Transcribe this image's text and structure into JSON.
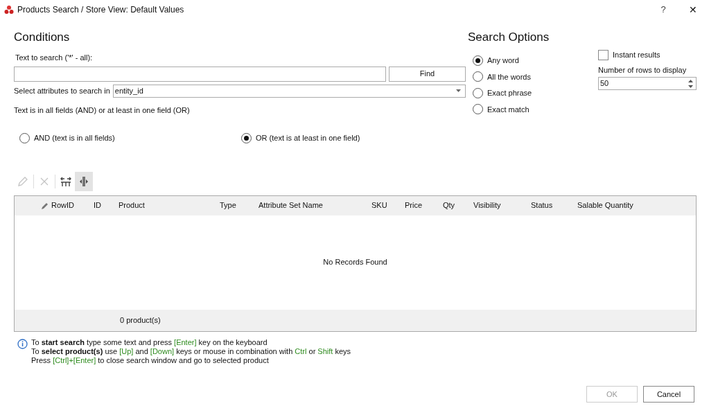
{
  "window": {
    "title": "Products Search / Store View: Default Values",
    "help": "?",
    "close": "✕"
  },
  "conditions": {
    "heading": "Conditions",
    "text_label": "Text to search ('*' - all):",
    "find_button": "Find",
    "attributes_label": "Select attributes to search in",
    "attributes_value": "entity_id",
    "logic_label": "Text is in all fields (AND) or at least in one field (OR)",
    "logic_options": [
      {
        "label": "AND (text is in all fields)",
        "selected": false
      },
      {
        "label": "OR (text is at least in one field)",
        "selected": true
      }
    ]
  },
  "search_options": {
    "heading": "Search Options",
    "modes": [
      {
        "label": "Any word",
        "selected": true
      },
      {
        "label": "All the words",
        "selected": false
      },
      {
        "label": "Exact phrase",
        "selected": false
      },
      {
        "label": "Exact match",
        "selected": false
      }
    ],
    "instant_results": {
      "label": "Instant results",
      "checked": false
    },
    "rows_label": "Number of rows to display",
    "rows_value": "50"
  },
  "toolbar": [
    {
      "kind": "edit",
      "disabled": true,
      "selected": false
    },
    {
      "kind": "delete",
      "disabled": true,
      "selected": false
    },
    {
      "kind": "fit",
      "disabled": false,
      "selected": false
    },
    {
      "kind": "columns",
      "disabled": false,
      "selected": true
    }
  ],
  "table": {
    "columns": [
      "RowID",
      "ID",
      "Product",
      "Type",
      "Attribute Set Name",
      "SKU",
      "Price",
      "Qty",
      "Visibility",
      "Status",
      "Salable Quantity"
    ],
    "empty_text": "No Records Found",
    "footer": "0 product(s)"
  },
  "help_lines": [
    [
      {
        "text": "To ",
        "kind": "plain"
      },
      {
        "text": "start search",
        "kind": "bold"
      },
      {
        "text": " type some text and press ",
        "kind": "plain"
      },
      {
        "text": "[Enter]",
        "kind": "key"
      },
      {
        "text": " key on the keyboard",
        "kind": "plain"
      }
    ],
    [
      {
        "text": "To ",
        "kind": "plain"
      },
      {
        "text": "select product(s)",
        "kind": "bold"
      },
      {
        "text": " use ",
        "kind": "plain"
      },
      {
        "text": "[Up]",
        "kind": "key"
      },
      {
        "text": " and ",
        "kind": "plain"
      },
      {
        "text": "[Down]",
        "kind": "key"
      },
      {
        "text": " keys or mouse in combination with ",
        "kind": "plain"
      },
      {
        "text": "Ctrl",
        "kind": "key"
      },
      {
        "text": " or ",
        "kind": "plain"
      },
      {
        "text": "Shift",
        "kind": "key"
      },
      {
        "text": " keys",
        "kind": "plain"
      }
    ],
    [
      {
        "text": "Press ",
        "kind": "plain"
      },
      {
        "text": "[Ctrl]+[Enter]",
        "kind": "key"
      },
      {
        "text": " to close search window and go to selected product",
        "kind": "plain"
      }
    ]
  ],
  "buttons": [
    {
      "label": "OK",
      "disabled": true
    },
    {
      "label": "Cancel",
      "disabled": false
    }
  ]
}
